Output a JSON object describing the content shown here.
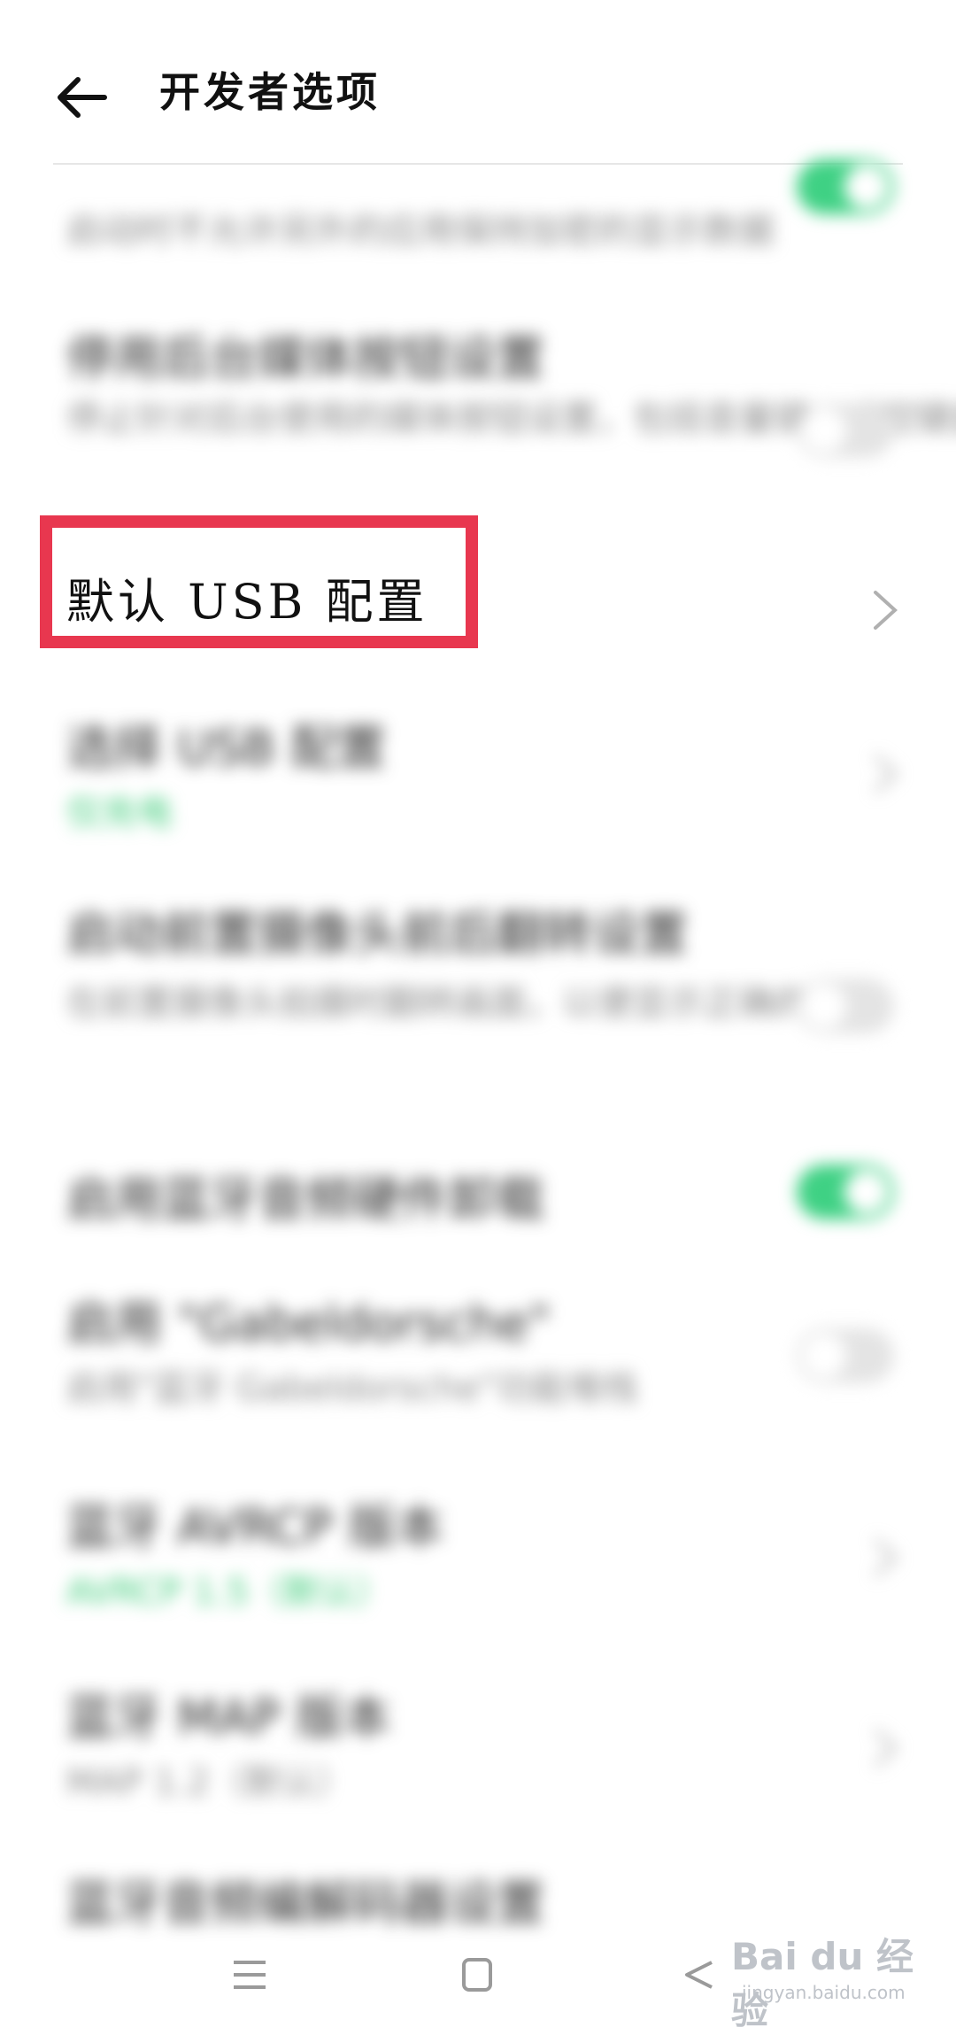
{
  "header": {
    "title": "开发者选项"
  },
  "rows": [
    {
      "title": "",
      "subtitle": "启动时不允许另外的应用保持加密的显示数据"
    },
    {
      "title": "停用后台媒体按钮设置",
      "subtitle": "停止针对后台使用的媒体按钮设置，包括音量键、遥控键盘"
    },
    {
      "title": "默认 USB 配置"
    },
    {
      "title": "选择 USB 配置",
      "subtitle": "仅充电"
    },
    {
      "title": "启动前置摄像头前后翻转设置",
      "subtitle": "在前置摄像头拍摄时翻转画面，以便显示正确的镜像"
    },
    {
      "title": "启用蓝牙音频硬件卸载"
    },
    {
      "title": "启用 \"Gabeldorsche\"",
      "subtitle": "启用\"蓝牙 Gabeldorsche\"功能堆栈"
    },
    {
      "title": "蓝牙 AVRCP 版本",
      "subtitle": "AVRCP 1.5（默认）"
    },
    {
      "title": "蓝牙 MAP 版本",
      "subtitle": "MAP 1.2（默认）"
    },
    {
      "title": "蓝牙音频编解码器设置"
    }
  ],
  "watermark": {
    "logo": "Bai du 经验",
    "sub": "jingyan.baidu.com"
  },
  "colors": {
    "highlight": "#e8374f",
    "accent_green": "#3fd184"
  },
  "icons": {
    "back": "arrow-left-icon",
    "chevron": "chevron-right-icon",
    "nav_menu": "menu-icon",
    "nav_home": "home-icon",
    "nav_back": "back-triangle-icon"
  }
}
